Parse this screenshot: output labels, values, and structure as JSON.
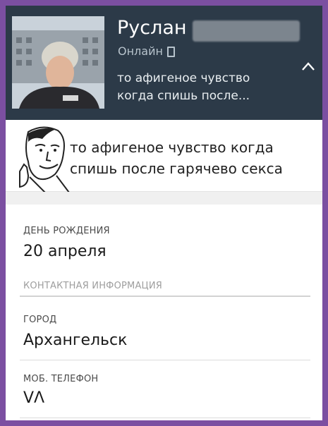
{
  "header": {
    "name": "Руслан",
    "online_status": "Онлайн",
    "status_message": "то афигеное чувство когда спишь после..."
  },
  "quote": {
    "text": "то афигеное чувство когда спишь после гарячево секса"
  },
  "info": {
    "birthday_label": "ДЕНЬ РОЖДЕНИЯ",
    "birthday_value": "20 апреля",
    "contact_section": "КОНТАКТНАЯ ИНФОРМАЦИЯ",
    "city_label": "ГОРОД",
    "city_value": "Архангельск",
    "phone_label": "МОБ. ТЕЛЕФОН",
    "phone_value": "VΛ"
  },
  "colors": {
    "frame_border": "#7b4fa1",
    "header_bg": "#2c3a48"
  },
  "icons": [
    "phone-icon",
    "chevron-up-icon",
    "meme-face-icon"
  ]
}
